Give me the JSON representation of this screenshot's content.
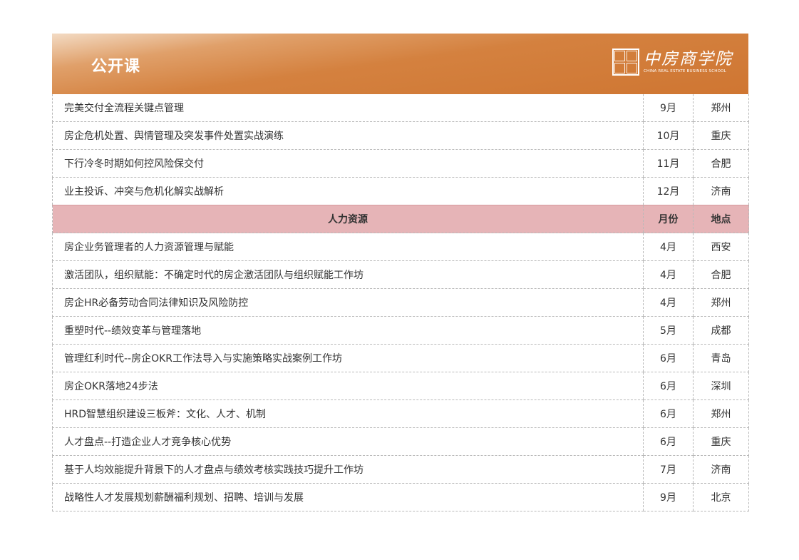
{
  "banner": {
    "title": "公开课",
    "logo_cn": "中房商学院",
    "logo_en": "CHINA REAL ESTATE BUSINESS SCHOOL"
  },
  "group1": [
    {
      "name": "完美交付全流程关键点管理",
      "month": "9月",
      "city": "郑州"
    },
    {
      "name": "房企危机处置、舆情管理及突发事件处置实战演练",
      "month": "10月",
      "city": "重庆"
    },
    {
      "name": "下行冷冬时期如何控风险保交付",
      "month": "11月",
      "city": "合肥"
    },
    {
      "name": "业主投诉、冲突与危机化解实战解析",
      "month": "12月",
      "city": "济南"
    }
  ],
  "section": {
    "title": "人力资源",
    "month_label": "月份",
    "city_label": "地点"
  },
  "group2": [
    {
      "name": "房企业务管理者的人力资源管理与赋能",
      "month": "4月",
      "city": "西安"
    },
    {
      "name": "激活团队，组织赋能：不确定时代的房企激活团队与组织赋能工作坊",
      "month": "4月",
      "city": "合肥"
    },
    {
      "name": "房企HR必备劳动合同法律知识及风险防控",
      "month": "4月",
      "city": "郑州"
    },
    {
      "name": "重塑时代--绩效变革与管理落地",
      "month": "5月",
      "city": "成都"
    },
    {
      "name": "管理红利时代--房企OKR工作法导入与实施策略实战案例工作坊",
      "month": "6月",
      "city": "青岛"
    },
    {
      "name": "房企OKR落地24步法",
      "month": "6月",
      "city": "深圳"
    },
    {
      "name": "HRD智慧组织建设三板斧：文化、人才、机制",
      "month": "6月",
      "city": "郑州"
    },
    {
      "name": "人才盘点--打造企业人才竞争核心优势",
      "month": "6月",
      "city": "重庆"
    },
    {
      "name": "基于人均效能提升背景下的人才盘点与绩效考核实践技巧提升工作坊",
      "month": "7月",
      "city": "济南"
    },
    {
      "name": "战略性人才发展规划薪酬福利规划、招聘、培训与发展",
      "month": "9月",
      "city": "北京"
    }
  ]
}
